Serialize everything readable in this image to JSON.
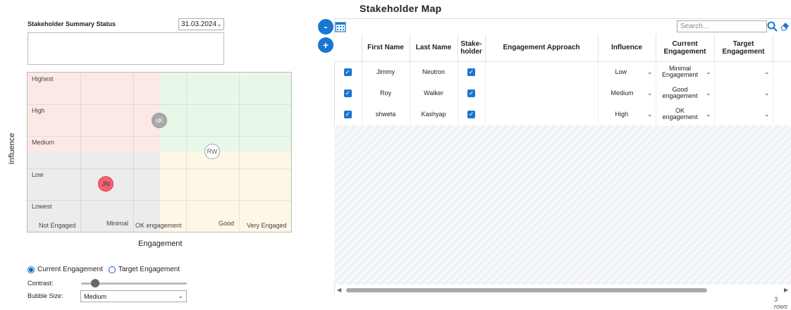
{
  "page": {
    "title": "Stakeholder Map"
  },
  "summary": {
    "label": "Stakeholder Summary Status",
    "date": "31.03.2024"
  },
  "matrix": {
    "influence_levels": [
      "Highest",
      "High",
      "Medium",
      "Low",
      "Lowest"
    ],
    "engagement_levels": [
      "Not Engaged",
      "Minimal",
      "OK engagement",
      "Good",
      "Very Engaged"
    ],
    "y_axis_label": "Influence",
    "x_axis_label": "Engagement",
    "bubbles": [
      {
        "initials": "sK",
        "color": "#aaaaaa"
      },
      {
        "initials": "RW",
        "color": "#ffffff"
      },
      {
        "initials": "JN",
        "color": "#f06272"
      }
    ]
  },
  "controls": {
    "radio_current": "Current Engagement",
    "radio_target": "Target Engagement",
    "contrast_label": "Contrast:",
    "contrast_value": 0.1,
    "bubble_size_label": "Bubble Size:",
    "bubble_size_value": "Medium"
  },
  "toolbar": {
    "collapse_label": "-",
    "add_label": "+",
    "search_placeholder": "Search..."
  },
  "table": {
    "columns": [
      "First Name",
      "Last Name",
      "Stake-holder",
      "Engagement Approach",
      "Influence",
      "Current Engagement",
      "Target Engagement"
    ],
    "rows": [
      {
        "first": "Jimmy",
        "last": "Neutron",
        "influence": "Low",
        "current": "Minimal Engagement",
        "target": ""
      },
      {
        "first": "Roy",
        "last": "Walker",
        "influence": "Medium",
        "current": "Good engagement",
        "target": ""
      },
      {
        "first": "shweta",
        "last": "Kashyap",
        "influence": "High",
        "current": "OK engagement",
        "target": ""
      }
    ],
    "rows_count": "3 rows"
  },
  "colors": {
    "accent": "#1976d2",
    "high_influence_low_eng": "#fde8e8",
    "high_influence_high_eng": "#e8f8e8",
    "low_influence": "#ececec",
    "low_influence_high_eng": "#fdf7e6"
  }
}
